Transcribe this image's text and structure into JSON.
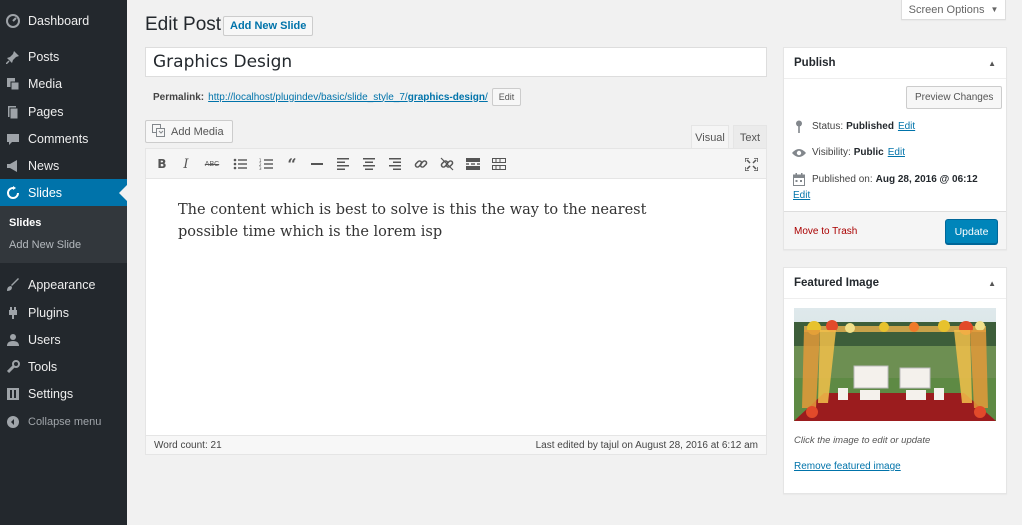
{
  "sidebar": {
    "items": [
      {
        "label": "Dashboard",
        "icon": "dashboard-icon"
      },
      {
        "label": "Posts",
        "icon": "pin-icon"
      },
      {
        "label": "Media",
        "icon": "media-icon"
      },
      {
        "label": "Pages",
        "icon": "page-icon"
      },
      {
        "label": "Comments",
        "icon": "comment-icon"
      },
      {
        "label": "News",
        "icon": "megaphone-icon"
      },
      {
        "label": "Slides",
        "icon": "slides-icon",
        "active": true
      },
      {
        "label": "Appearance",
        "icon": "brush-icon"
      },
      {
        "label": "Plugins",
        "icon": "plug-icon"
      },
      {
        "label": "Users",
        "icon": "user-icon"
      },
      {
        "label": "Tools",
        "icon": "wrench-icon"
      },
      {
        "label": "Settings",
        "icon": "settings-icon"
      }
    ],
    "submenu": [
      "Slides",
      "Add New Slide"
    ],
    "collapse": "Collapse menu"
  },
  "header": {
    "screen_options": "Screen Options",
    "title": "Edit Post",
    "add_new": "Add New Slide"
  },
  "post": {
    "title": "Graphics Design",
    "permalink_label": "Permalink:",
    "permalink_base": "http://localhost/plugindev/basic/slide_style_7/",
    "permalink_slug": "graphics-design",
    "permalink_trail": "/",
    "permalink_edit": "Edit"
  },
  "editor": {
    "add_media": "Add Media",
    "tab_visual": "Visual",
    "tab_text": "Text",
    "content": "The content which is best to solve is this the way to the nearest possible time which is the lorem isp",
    "word_count": "Word count: 21",
    "last_edited": "Last edited by tajul on August 28, 2016 at 6:12 am"
  },
  "publish": {
    "title": "Publish",
    "preview": "Preview Changes",
    "status_label": "Status:",
    "status_value": "Published",
    "visibility_label": "Visibility:",
    "visibility_value": "Public",
    "published_label": "Published on:",
    "published_value": "Aug 28, 2016 @ 06:12",
    "edit": "Edit",
    "trash": "Move to Trash",
    "update": "Update"
  },
  "featured": {
    "title": "Featured Image",
    "hint": "Click the image to edit or update",
    "remove": "Remove featured image"
  },
  "colors": {
    "sidebar_bg": "#23282d",
    "active": "#0073aa",
    "primary_button": "#0085ba",
    "link": "#0073aa",
    "trash": "#a00"
  }
}
